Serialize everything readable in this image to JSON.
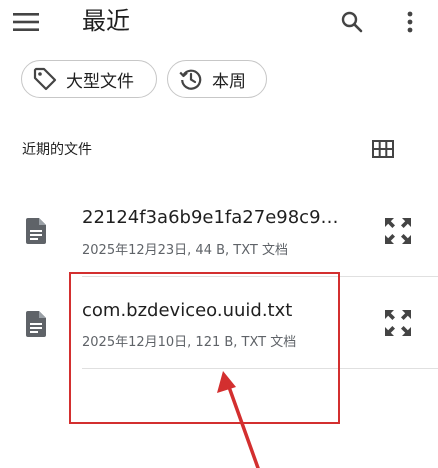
{
  "app_bar": {
    "title": "最近",
    "menu_icon": "menu-icon",
    "search_icon": "search-icon",
    "more_icon": "more-vert-icon"
  },
  "chips": [
    {
      "label": "大型文件",
      "icon": "tag-icon"
    },
    {
      "label": "本周",
      "icon": "history-icon"
    }
  ],
  "section": {
    "title": "近期的文件",
    "view_icon": "grid-view-icon"
  },
  "files": [
    {
      "name": "22124f3a6b9e1fa27e98c9…",
      "meta": "2025年12月23日, 44 B, TXT 文档",
      "icon": "document-icon",
      "action_icon": "expand-icon"
    },
    {
      "name": "com.bzdeviceo.uuid.txt",
      "meta": "2025年12月10日, 121 B, TXT 文档",
      "icon": "document-icon",
      "action_icon": "expand-icon"
    }
  ],
  "colors": {
    "icon_gray": "#5f6368",
    "annotation_red": "#d32f2f",
    "chip_border": "#c7c7c7"
  }
}
